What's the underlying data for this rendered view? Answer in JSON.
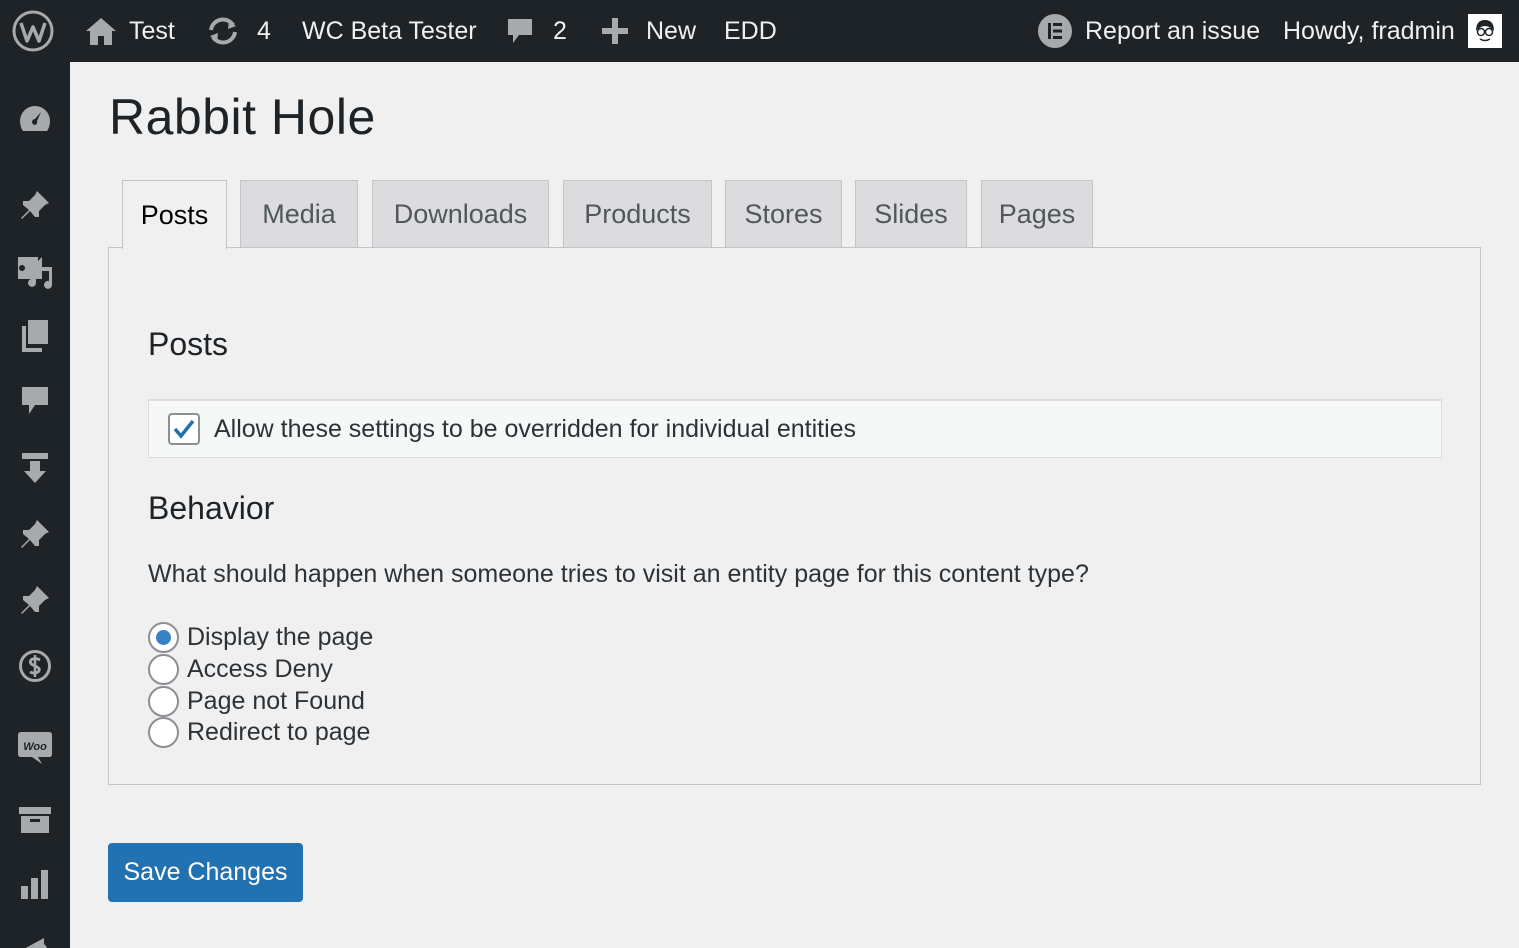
{
  "admin_bar": {
    "site_name": "Test",
    "updates_count": "4",
    "plugin_link": "WC Beta Tester",
    "comments_count": "2",
    "new_label": "New",
    "edd_label": "EDD",
    "report_issue": "Report an issue",
    "howdy": "Howdy, fradmin"
  },
  "sidebar": {
    "icons": [
      "dashboard-icon",
      "posts-icon",
      "media-icon",
      "pages-icon",
      "comments-icon",
      "downloads-icon",
      "pin-icon",
      "pin-icon-2",
      "dollar-icon",
      "woo-icon",
      "archive-icon",
      "chart-icon",
      "megaphone-icon"
    ]
  },
  "page": {
    "title": "Rabbit Hole"
  },
  "tabs": [
    {
      "label": "Posts",
      "active": true
    },
    {
      "label": "Media",
      "active": false
    },
    {
      "label": "Downloads",
      "active": false
    },
    {
      "label": "Products",
      "active": false
    },
    {
      "label": "Stores",
      "active": false
    },
    {
      "label": "Slides",
      "active": false
    },
    {
      "label": "Pages",
      "active": false
    }
  ],
  "panel": {
    "section_title": "Posts",
    "override_label": "Allow these settings to be overridden for individual entities",
    "override_checked": true,
    "behavior_title": "Behavior",
    "question": "What should happen when someone tries to visit an entity page for this content type?",
    "options": [
      {
        "label": "Display the page",
        "checked": true
      },
      {
        "label": "Access Deny",
        "checked": false
      },
      {
        "label": "Page not Found",
        "checked": false
      },
      {
        "label": "Redirect to page",
        "checked": false
      }
    ]
  },
  "save_label": "Save Changes",
  "colors": {
    "admin_bar_bg": "#1d2327",
    "primary_button": "#2271b1",
    "radio_checked": "#3582c4"
  }
}
